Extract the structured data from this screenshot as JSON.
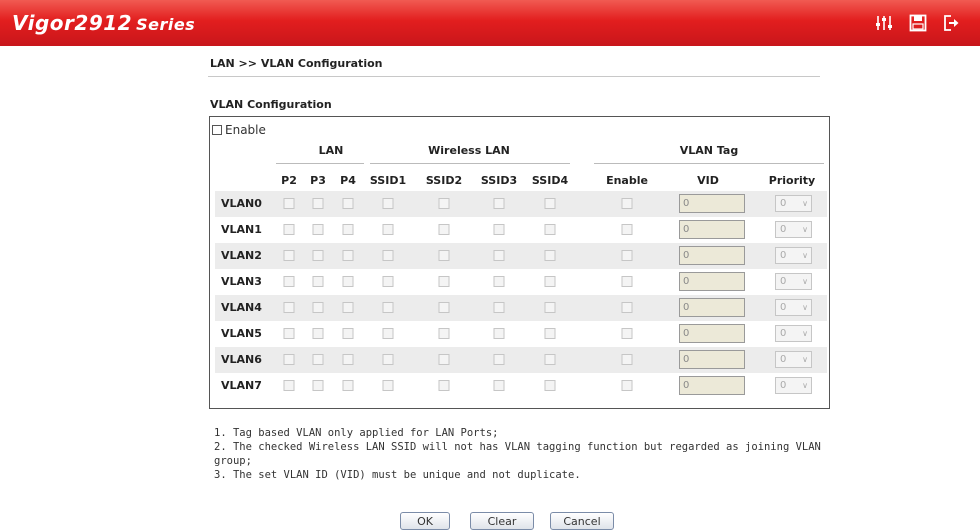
{
  "header": {
    "brand": "Vigor2912",
    "series": "Series",
    "icons": [
      "quick-start-wizard-icon",
      "save-icon",
      "logout-icon"
    ]
  },
  "breadcrumb": "LAN >> VLAN Configuration",
  "section_title": "VLAN Configuration",
  "enable_label": "Enable",
  "groups": {
    "lan": "LAN",
    "wireless": "Wireless LAN",
    "vlan_tag": "VLAN Tag"
  },
  "columns": [
    "P2",
    "P3",
    "P4",
    "SSID1",
    "SSID2",
    "SSID3",
    "SSID4",
    "Enable",
    "VID",
    "Priority"
  ],
  "rows": [
    {
      "label": "VLAN0",
      "vid": "0",
      "priority": "0"
    },
    {
      "label": "VLAN1",
      "vid": "0",
      "priority": "0"
    },
    {
      "label": "VLAN2",
      "vid": "0",
      "priority": "0"
    },
    {
      "label": "VLAN3",
      "vid": "0",
      "priority": "0"
    },
    {
      "label": "VLAN4",
      "vid": "0",
      "priority": "0"
    },
    {
      "label": "VLAN5",
      "vid": "0",
      "priority": "0"
    },
    {
      "label": "VLAN6",
      "vid": "0",
      "priority": "0"
    },
    {
      "label": "VLAN7",
      "vid": "0",
      "priority": "0"
    }
  ],
  "notes": [
    "1. Tag based VLAN only applied for LAN Ports;",
    "2. The checked Wireless LAN SSID will not has VLAN tagging function but regarded as joining VLAN group;",
    "3. The set VLAN ID (VID) must be unique and not duplicate."
  ],
  "buttons": {
    "ok": "OK",
    "clear": "Clear",
    "cancel": "Cancel"
  },
  "colors": {
    "header_red": "#e21e1e",
    "row_shade": "#ececec"
  }
}
